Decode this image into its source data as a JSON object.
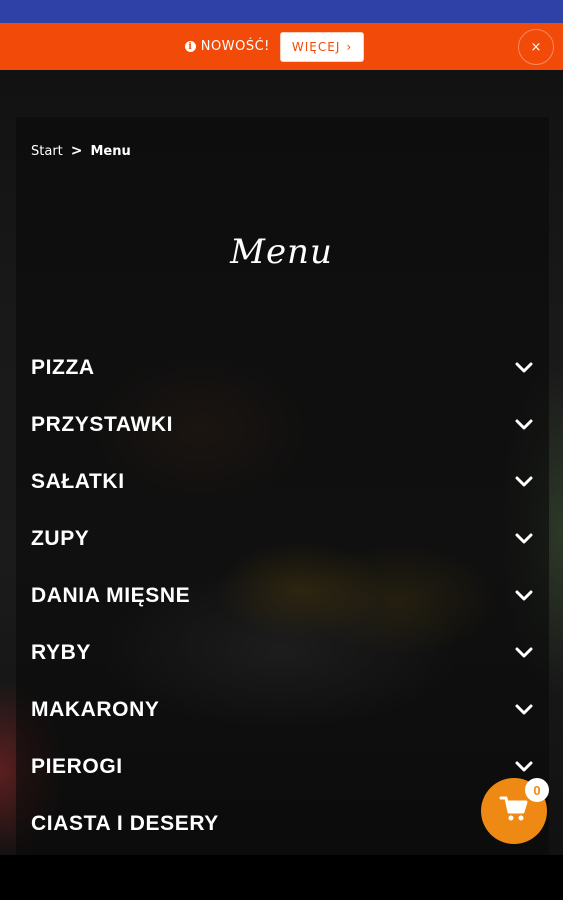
{
  "colors": {
    "top_bar": "#2f40a6",
    "notice_bar": "#f24a08",
    "cart_accent": "#ee8a14"
  },
  "notice": {
    "icon": "info-icon",
    "text": "NOWOŚĆ!",
    "more_label": "WIĘCEJ",
    "more_icon": "chevron-right-icon",
    "close_label": "×"
  },
  "breadcrumb": {
    "home": "Start",
    "separator_icon": "chevron-right-icon",
    "current": "Menu"
  },
  "page": {
    "title": "Menu"
  },
  "menu": {
    "items": [
      {
        "label": "PIZZA"
      },
      {
        "label": "PRZYSTAWKI"
      },
      {
        "label": "SAŁATKI"
      },
      {
        "label": "ZUPY"
      },
      {
        "label": "DANIA MIĘSNE"
      },
      {
        "label": "RYBY"
      },
      {
        "label": "MAKARONY"
      },
      {
        "label": "PIEROGI"
      },
      {
        "label": "CIASTA I DESERY"
      }
    ],
    "expand_icon": "chevron-down-icon"
  },
  "cart": {
    "icon": "cart-icon",
    "count": "0"
  }
}
